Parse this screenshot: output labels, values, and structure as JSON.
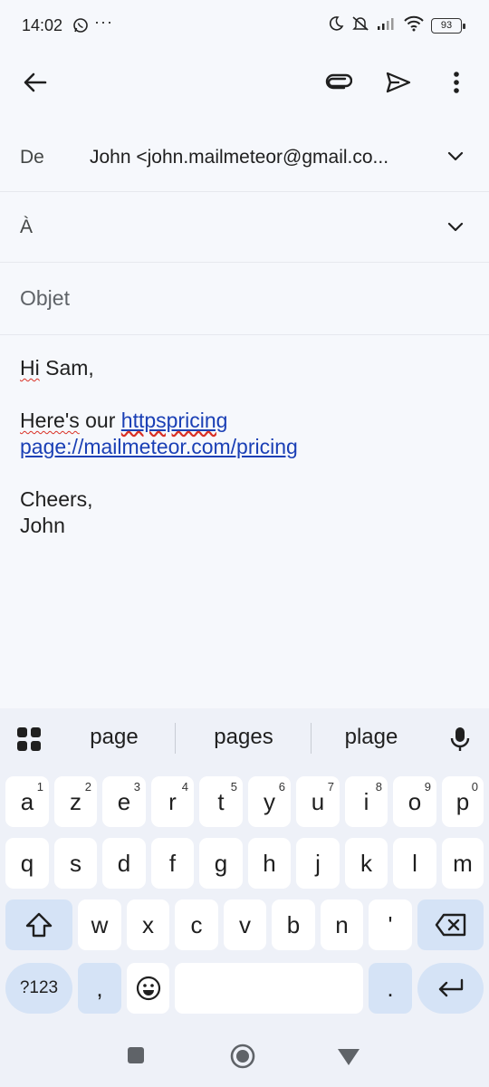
{
  "status_bar": {
    "time": "14:02",
    "overflow": "···",
    "battery": "93",
    "icons": [
      "whatsapp-icon",
      "moon-icon",
      "mute-icon",
      "signal-icon",
      "wifi-icon",
      "battery-icon"
    ]
  },
  "toolbar": {
    "icons": [
      "back-arrow-icon",
      "attach-icon",
      "send-icon",
      "more-vert-icon"
    ]
  },
  "compose": {
    "from_label": "De",
    "from_value": "John <john.mailmeteor@gmail.co...",
    "to_label": "À",
    "subject_placeholder": "Objet",
    "body": {
      "greeting_word": "Hi",
      "greeting_rest": " Sam,",
      "line2_word": "Here's",
      "line2_mid": " our ",
      "link_part1": "httpspricing",
      "link_part2": "page://mailmeteor.com/pricing",
      "signoff": "Cheers,",
      "signature": "John"
    }
  },
  "suggestions": {
    "items": [
      "page",
      "pages",
      "plage"
    ],
    "icons": [
      "apps-grid-icon",
      "mic-icon"
    ]
  },
  "keyboard": {
    "row1": [
      {
        "k": "a",
        "h": "1"
      },
      {
        "k": "z",
        "h": "2"
      },
      {
        "k": "e",
        "h": "3"
      },
      {
        "k": "r",
        "h": "4"
      },
      {
        "k": "t",
        "h": "5"
      },
      {
        "k": "y",
        "h": "6"
      },
      {
        "k": "u",
        "h": "7"
      },
      {
        "k": "i",
        "h": "8"
      },
      {
        "k": "o",
        "h": "9"
      },
      {
        "k": "p",
        "h": "0"
      }
    ],
    "row2": [
      "q",
      "s",
      "d",
      "f",
      "g",
      "h",
      "j",
      "k",
      "l",
      "m"
    ],
    "row3": [
      "w",
      "x",
      "c",
      "v",
      "b",
      "n",
      "'"
    ],
    "symbols_label": "?123",
    "comma": ",",
    "period": "."
  },
  "colors": {
    "background": "#f6f8fc",
    "keyboard": "#eef1f8",
    "function_key": "#d5e3f6",
    "link": "#1a3fb5",
    "spellcheck": "#d93025"
  }
}
